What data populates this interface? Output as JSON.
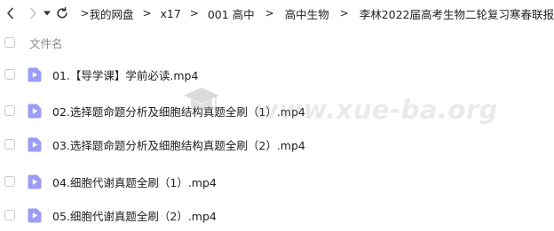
{
  "nav": {
    "back_icon": "chevron-left-icon",
    "forward_icon": "chevron-right-icon",
    "dropdown_icon": "caret-down-icon",
    "refresh_icon": "refresh-icon"
  },
  "breadcrumb": {
    "separator": ">",
    "items": [
      {
        "label": "我的网盘"
      },
      {
        "label": "x17"
      },
      {
        "label": "001 高中"
      },
      {
        "label": "高中生物"
      },
      {
        "label": "李林2022届高考生物二轮复习寒春联报"
      }
    ]
  },
  "list_header": {
    "name_column": "文件名"
  },
  "files": [
    {
      "name": "01.【导学课】学前必读.mp4",
      "icon": "video-file-icon"
    },
    {
      "name": "02.选择题命题分析及细胞结构真题全刷（1）.mp4",
      "icon": "video-file-icon"
    },
    {
      "name": "03.选择题命题分析及细胞结构真题全刷（2）.mp4",
      "icon": "video-file-icon"
    },
    {
      "name": "04.细胞代谢真题全刷（1）.mp4",
      "icon": "video-file-icon"
    },
    {
      "name": "05.细胞代谢真题全刷（2）.mp4",
      "icon": "video-file-icon"
    }
  ],
  "watermark": {
    "text": "www.xue-ba.org",
    "icon": "graduation-cap-logo"
  },
  "colors": {
    "file_icon_fill": "#9c9cf5",
    "file_icon_play": "#ffffff",
    "checkbox_border": "#c9c9c9",
    "header_text": "#888888"
  }
}
